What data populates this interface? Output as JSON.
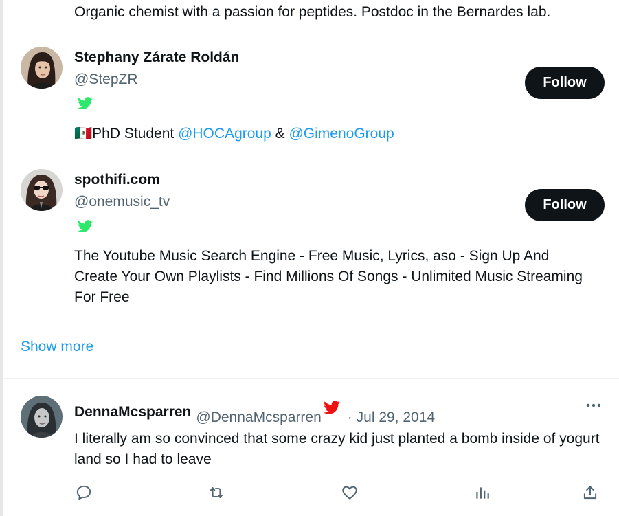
{
  "top_bio": "Organic chemist with a passion for peptides. Postdoc in the Bernardes lab.",
  "users": [
    {
      "name": "Stephany Zárate Roldán",
      "handle": "@StepZR",
      "bio_flag": "🇲🇽",
      "bio_prefix": "PhD Student ",
      "bio_link1": "@HOCAgroup",
      "bio_mid": " & ",
      "bio_link2": "@GimenoGroup",
      "follow_label": "Follow",
      "badge_color": "#2ee86b"
    },
    {
      "name": "spothifi.com",
      "handle": "@onemusic_tv",
      "bio": "The Youtube Music Search Engine - Free Music, Lyrics, aso - Sign Up And Create Your Own Playlists - Find Millions Of Songs - Unlimited Music Streaming For Free",
      "follow_label": "Follow",
      "badge_color": "#2ee86b"
    }
  ],
  "show_more": "Show more",
  "tweet": {
    "name": "DennaMcsparren",
    "handle": "@DennaMcsparren",
    "separator": "·",
    "date": "Jul 29, 2014",
    "text": "I literally am so convinced that some crazy kid just planted a bomb inside of yogurt land so I had to leave",
    "badge_color": "#ee1111",
    "actions": [
      "reply-icon",
      "retweet-icon",
      "like-icon",
      "views-icon",
      "share-icon"
    ]
  },
  "colors": {
    "accent": "#1d9bf0",
    "text_primary": "#0f1419",
    "text_secondary": "#536471",
    "button_bg": "#0f1419"
  }
}
